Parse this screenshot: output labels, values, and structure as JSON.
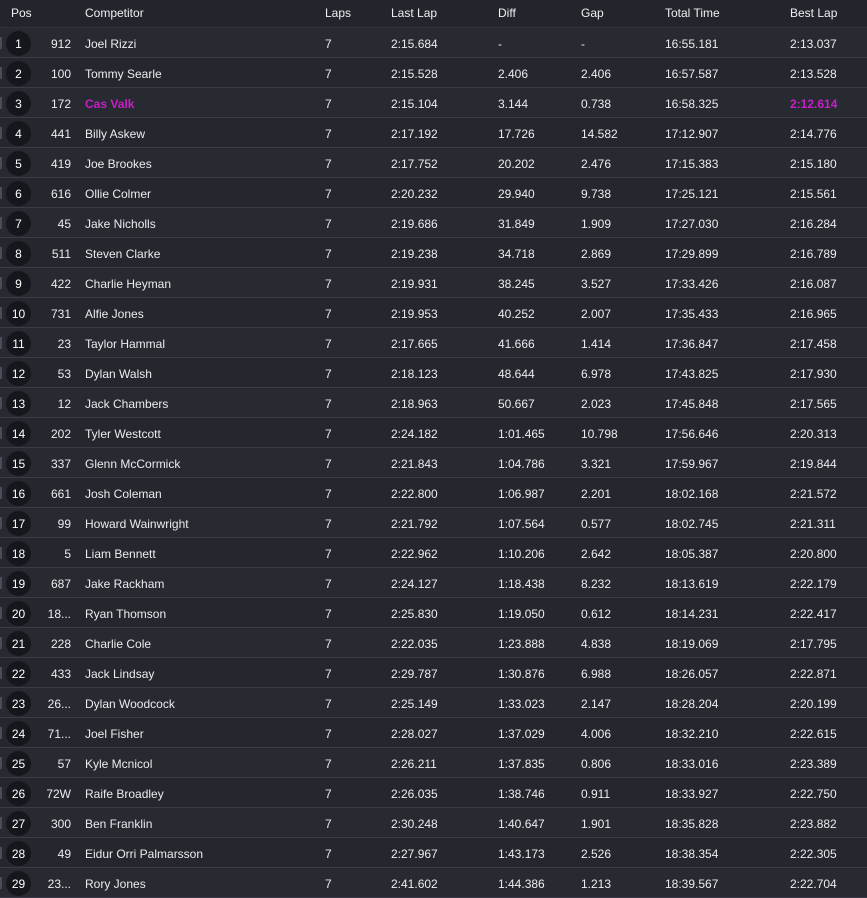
{
  "header": {
    "pos": "Pos",
    "competitor": "Competitor",
    "laps": "Laps",
    "last_lap": "Last Lap",
    "diff": "Diff",
    "gap": "Gap",
    "total_time": "Total Time",
    "best_lap": "Best Lap"
  },
  "colors": {
    "highlight": "#c81fc8"
  },
  "rows": [
    {
      "pos": "1",
      "num": "912",
      "name": "Joel Rizzi",
      "laps": "7",
      "last": "2:15.684",
      "diff": "-",
      "gap": "-",
      "total": "16:55.181",
      "best": "2:13.037"
    },
    {
      "pos": "2",
      "num": "100",
      "name": "Tommy Searle",
      "laps": "7",
      "last": "2:15.528",
      "diff": "2.406",
      "gap": "2.406",
      "total": "16:57.587",
      "best": "2:13.528"
    },
    {
      "pos": "3",
      "num": "172",
      "name": "Cas Valk",
      "laps": "7",
      "last": "2:15.104",
      "diff": "3.144",
      "gap": "0.738",
      "total": "16:58.325",
      "best": "2:12.614",
      "highlight": true
    },
    {
      "pos": "4",
      "num": "441",
      "name": "Billy Askew",
      "laps": "7",
      "last": "2:17.192",
      "diff": "17.726",
      "gap": "14.582",
      "total": "17:12.907",
      "best": "2:14.776"
    },
    {
      "pos": "5",
      "num": "419",
      "name": "Joe Brookes",
      "laps": "7",
      "last": "2:17.752",
      "diff": "20.202",
      "gap": "2.476",
      "total": "17:15.383",
      "best": "2:15.180"
    },
    {
      "pos": "6",
      "num": "616",
      "name": "Ollie Colmer",
      "laps": "7",
      "last": "2:20.232",
      "diff": "29.940",
      "gap": "9.738",
      "total": "17:25.121",
      "best": "2:15.561"
    },
    {
      "pos": "7",
      "num": "45",
      "name": "Jake Nicholls",
      "laps": "7",
      "last": "2:19.686",
      "diff": "31.849",
      "gap": "1.909",
      "total": "17:27.030",
      "best": "2:16.284"
    },
    {
      "pos": "8",
      "num": "511",
      "name": "Steven Clarke",
      "laps": "7",
      "last": "2:19.238",
      "diff": "34.718",
      "gap": "2.869",
      "total": "17:29.899",
      "best": "2:16.789"
    },
    {
      "pos": "9",
      "num": "422",
      "name": "Charlie Heyman",
      "laps": "7",
      "last": "2:19.931",
      "diff": "38.245",
      "gap": "3.527",
      "total": "17:33.426",
      "best": "2:16.087"
    },
    {
      "pos": "10",
      "num": "731",
      "name": "Alfie Jones",
      "laps": "7",
      "last": "2:19.953",
      "diff": "40.252",
      "gap": "2.007",
      "total": "17:35.433",
      "best": "2:16.965"
    },
    {
      "pos": "11",
      "num": "23",
      "name": "Taylor Hammal",
      "laps": "7",
      "last": "2:17.665",
      "diff": "41.666",
      "gap": "1.414",
      "total": "17:36.847",
      "best": "2:17.458"
    },
    {
      "pos": "12",
      "num": "53",
      "name": "Dylan Walsh",
      "laps": "7",
      "last": "2:18.123",
      "diff": "48.644",
      "gap": "6.978",
      "total": "17:43.825",
      "best": "2:17.930"
    },
    {
      "pos": "13",
      "num": "12",
      "name": "Jack Chambers",
      "laps": "7",
      "last": "2:18.963",
      "diff": "50.667",
      "gap": "2.023",
      "total": "17:45.848",
      "best": "2:17.565"
    },
    {
      "pos": "14",
      "num": "202",
      "name": "Tyler Westcott",
      "laps": "7",
      "last": "2:24.182",
      "diff": "1:01.465",
      "gap": "10.798",
      "total": "17:56.646",
      "best": "2:20.313"
    },
    {
      "pos": "15",
      "num": "337",
      "name": "Glenn McCormick",
      "laps": "7",
      "last": "2:21.843",
      "diff": "1:04.786",
      "gap": "3.321",
      "total": "17:59.967",
      "best": "2:19.844"
    },
    {
      "pos": "16",
      "num": "661",
      "name": "Josh Coleman",
      "laps": "7",
      "last": "2:22.800",
      "diff": "1:06.987",
      "gap": "2.201",
      "total": "18:02.168",
      "best": "2:21.572"
    },
    {
      "pos": "17",
      "num": "99",
      "name": "Howard Wainwright",
      "laps": "7",
      "last": "2:21.792",
      "diff": "1:07.564",
      "gap": "0.577",
      "total": "18:02.745",
      "best": "2:21.311"
    },
    {
      "pos": "18",
      "num": "5",
      "name": "Liam Bennett",
      "laps": "7",
      "last": "2:22.962",
      "diff": "1:10.206",
      "gap": "2.642",
      "total": "18:05.387",
      "best": "2:20.800"
    },
    {
      "pos": "19",
      "num": "687",
      "name": "Jake Rackham",
      "laps": "7",
      "last": "2:24.127",
      "diff": "1:18.438",
      "gap": "8.232",
      "total": "18:13.619",
      "best": "2:22.179"
    },
    {
      "pos": "20",
      "num": "18...",
      "name": "Ryan Thomson",
      "laps": "7",
      "last": "2:25.830",
      "diff": "1:19.050",
      "gap": "0.612",
      "total": "18:14.231",
      "best": "2:22.417"
    },
    {
      "pos": "21",
      "num": "228",
      "name": "Charlie Cole",
      "laps": "7",
      "last": "2:22.035",
      "diff": "1:23.888",
      "gap": "4.838",
      "total": "18:19.069",
      "best": "2:17.795"
    },
    {
      "pos": "22",
      "num": "433",
      "name": "Jack Lindsay",
      "laps": "7",
      "last": "2:29.787",
      "diff": "1:30.876",
      "gap": "6.988",
      "total": "18:26.057",
      "best": "2:22.871"
    },
    {
      "pos": "23",
      "num": "26...",
      "name": "Dylan Woodcock",
      "laps": "7",
      "last": "2:25.149",
      "diff": "1:33.023",
      "gap": "2.147",
      "total": "18:28.204",
      "best": "2:20.199"
    },
    {
      "pos": "24",
      "num": "71...",
      "name": "Joel Fisher",
      "laps": "7",
      "last": "2:28.027",
      "diff": "1:37.029",
      "gap": "4.006",
      "total": "18:32.210",
      "best": "2:22.615"
    },
    {
      "pos": "25",
      "num": "57",
      "name": "Kyle Mcnicol",
      "laps": "7",
      "last": "2:26.211",
      "diff": "1:37.835",
      "gap": "0.806",
      "total": "18:33.016",
      "best": "2:23.389"
    },
    {
      "pos": "26",
      "num": "72W",
      "name": "Raife Broadley",
      "laps": "7",
      "last": "2:26.035",
      "diff": "1:38.746",
      "gap": "0.911",
      "total": "18:33.927",
      "best": "2:22.750"
    },
    {
      "pos": "27",
      "num": "300",
      "name": "Ben Franklin",
      "laps": "7",
      "last": "2:30.248",
      "diff": "1:40.647",
      "gap": "1.901",
      "total": "18:35.828",
      "best": "2:23.882"
    },
    {
      "pos": "28",
      "num": "49",
      "name": "Eidur Orri Palmarsson",
      "laps": "7",
      "last": "2:27.967",
      "diff": "1:43.173",
      "gap": "2.526",
      "total": "18:38.354",
      "best": "2:22.305"
    },
    {
      "pos": "29",
      "num": "23...",
      "name": "Rory Jones",
      "laps": "7",
      "last": "2:41.602",
      "diff": "1:44.386",
      "gap": "1.213",
      "total": "18:39.567",
      "best": "2:22.704"
    }
  ]
}
